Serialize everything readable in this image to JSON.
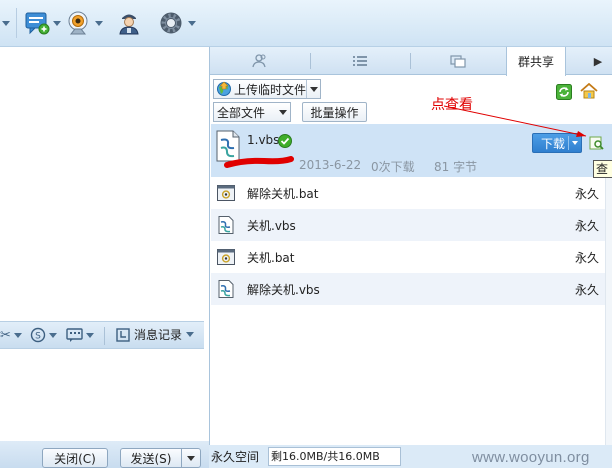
{
  "toolbar": {
    "icons": [
      "chat-add-icon",
      "webcam-icon",
      "contact-card-icon",
      "gear-icon"
    ]
  },
  "left": {
    "history_label": "消息记录",
    "close_label": "关闭(C)",
    "send_label": "发送(S)"
  },
  "tabs": {
    "active_label": "群共享"
  },
  "share": {
    "upload_label": "上传临时文件",
    "filter_label": "全部文件",
    "batch_label": "批量操作",
    "annotation": "点查看",
    "tooltip": "查看",
    "download_label": "下载",
    "selected": {
      "name": "1.vbs",
      "date": "2013-6-22",
      "downloads": "0次下载",
      "size": "81 字节"
    },
    "files": [
      {
        "name": "解除关机.bat",
        "expiry": "永久",
        "type": "bat"
      },
      {
        "name": "关机.vbs",
        "expiry": "永久",
        "type": "vbs"
      },
      {
        "name": "关机.bat",
        "expiry": "永久",
        "type": "bat"
      },
      {
        "name": "解除关机.vbs",
        "expiry": "永久",
        "type": "vbs"
      }
    ]
  },
  "status": {
    "space_label": "永久空间",
    "quota": "剩16.0MB/共16.0MB"
  },
  "watermark": "www.wooyun.org",
  "colors": {
    "accent": "#2f7fcf",
    "annotation": "#e00000",
    "check": "#3fae2a"
  }
}
